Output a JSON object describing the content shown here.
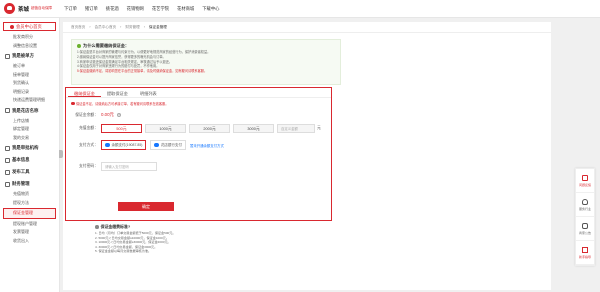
{
  "topbar": {
    "logo_text": "茶城",
    "logo_tag": "超值自动保障",
    "nav": [
      "下订单",
      "猪订单",
      "挑花酒",
      "花销物网",
      "花艺学院",
      "花材商城",
      "下载中心"
    ]
  },
  "sidebar": {
    "home_label": "会员中心首页",
    "top_items": [
      "批发商积分",
      "调整信息设置"
    ],
    "groups": [
      {
        "title": "我是被单方",
        "items": [
          "被订单",
          "接单管理",
          "到货确认",
          "明细记录",
          "快递运费管理明细"
        ]
      },
      {
        "title": "我是花店名称",
        "items": [
          "上传店铺",
          "绑定管理",
          "我的交易"
        ]
      },
      {
        "title": "我是审批机构",
        "items": []
      },
      {
        "title": "基本信息",
        "items": []
      },
      {
        "title": "发布工具",
        "items": []
      },
      {
        "title": "财务管理",
        "items": [
          "充值物资",
          "提现方法"
        ]
      }
    ],
    "highlighted_item": "保证金管理",
    "after_items": [
      "提现账户管理",
      "发票管理",
      "收货出入"
    ]
  },
  "breadcrumb": [
    "首页首页",
    "会员中心首页",
    "财务管理",
    "保证金管理"
  ],
  "info": {
    "title": "为什么需要缴纳保证金：",
    "lines": [
      "1.保证金是平台对商家的管理与约束行为，以便更好地规范商家的经营行为，保护消费者权益。",
      "2.缴纳保证金可以提升商家信誉，获得更多的曝光机会与订单。",
      "3.商家申请退还保证金需满足平台相关规定，审核通过后予以退还。",
      "4.保证金仅用于对商家违规行为的赔付与处罚，不作他用。"
    ],
    "warning_line": "5.保证金缴纳不足，将影响您在平台的正常接单，请及时缴纳保证金，如有疑问请联系客服。"
  },
  "tabs": [
    {
      "label": "缴纳保证金",
      "active": true
    },
    {
      "label": "提取保证金",
      "active": false
    },
    {
      "label": "明细列表",
      "active": false
    }
  ],
  "warning": "保证金不足，请缴纳后方可承接订单，若有疑问请联系在线客服。",
  "form": {
    "balance_label": "保证金余额：",
    "balance_value": "0.00元",
    "amount_label": "充值金额：",
    "amounts": [
      {
        "label": "500元",
        "selected": true
      },
      {
        "label": "1000元",
        "selected": false
      },
      {
        "label": "2000元",
        "selected": false
      },
      {
        "label": "3000元",
        "selected": false
      }
    ],
    "custom_amount_placeholder": "自定义金额",
    "unit": "元",
    "method_label": "支付方式：",
    "methods": [
      {
        "label": "余额支付(19087.85)",
        "selected": true
      },
      {
        "label": "花店银行支付",
        "selected": false
      }
    ],
    "method_link": "暂未开通余额支付方式",
    "password_label": "支付密码：",
    "password_placeholder": "请输入支付密码",
    "confirm": "确定"
  },
  "tips": {
    "title": "保证金缴费标准?",
    "lines": [
      "1. 日均（月均）订单交易金额低于5000元，保证金500元。",
      "2. 5000元＜日均交易金额≤10000元，保证金1000元。",
      "3. 10000元＜日均交易金额≤30000元，保证金2000元。",
      "4. 30000元＜日均交易金额，保证金3000元。",
      "5. 保证金金额以每月交易数据审核为准。"
    ]
  },
  "floatbar": [
    {
      "label": "问题反馈",
      "icon": "document-icon",
      "red": true
    },
    {
      "label": "服务行业",
      "icon": "person-icon",
      "red": false
    },
    {
      "label": "商家公告",
      "icon": "chat-icon",
      "red": false
    },
    {
      "label": "新手指导",
      "icon": "book-icon",
      "red": true
    }
  ]
}
